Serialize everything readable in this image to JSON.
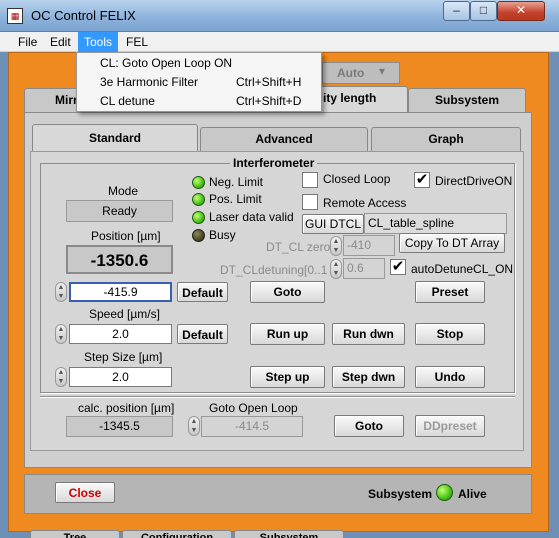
{
  "window": {
    "title": "OC Control FELIX"
  },
  "menubar": {
    "file": "File",
    "edit": "Edit",
    "tools": "Tools",
    "fel": "FEL"
  },
  "tools_menu": [
    {
      "label": "CL: Goto Open Loop ON",
      "shortcut": ""
    },
    {
      "label": "3e Harmonic Filter",
      "shortcut": "Ctrl+Shift+H"
    },
    {
      "label": "CL detune",
      "shortcut": "Ctrl+Shift+D"
    }
  ],
  "top": {
    "auto_label": "Auto",
    "tabs": [
      "Mirr",
      "ity length",
      "Subsystem"
    ]
  },
  "subtabs": [
    "Standard",
    "Advanced",
    "Graph"
  ],
  "interferometer": {
    "title": "Interferometer",
    "mode_label": "Mode",
    "mode_value": "Ready",
    "position_label": "Position [µm]",
    "position_value": "-1350.6",
    "leds": [
      "Neg. Limit",
      "Pos. Limit",
      "Laser data valid",
      "Busy"
    ],
    "closed_loop": "Closed Loop",
    "remote_access": "Remote Access",
    "direct_drive": "DirectDriveON",
    "gui_dtcl": "GUI DTCL",
    "cl_table": "CL_table_spline",
    "dt_cl_zero_label": "DT_CL zero",
    "dt_cl_zero_value": "-410",
    "copy_button": "Copy To DT Array",
    "dt_cldetuning_label": "DT_CLdetuning[0..1",
    "dt_cldetuning_value": "0.6",
    "auto_detune": "autoDetuneCL_ON",
    "target_value": "-415.9",
    "default_label": "Default",
    "goto_label": "Goto",
    "preset_label": "Preset",
    "speed_label": "Speed [µm/s]",
    "speed_value": "2.0",
    "run_up": "Run up",
    "run_dwn": "Run dwn",
    "stop": "Stop",
    "step_label": "Step Size [µm]",
    "step_value": "2.0",
    "step_up": "Step up",
    "step_dwn": "Step dwn",
    "undo": "Undo",
    "calc_label": "calc. position [µm]",
    "calc_value": "-1345.5",
    "open_loop_label": "Goto Open Loop",
    "open_loop_value": "-414.5",
    "goto2": "Goto",
    "ddpreset": "DDpreset"
  },
  "footer": {
    "close": "Close",
    "subsystem": "Subsystem",
    "alive": "Alive",
    "bottom_tabs": [
      "Tree",
      "Configuration",
      "Subsystem"
    ]
  },
  "colors": {
    "panel_orange": "#ee8a20",
    "led_green": "#4cc81a",
    "close_red": "#cc0000"
  }
}
